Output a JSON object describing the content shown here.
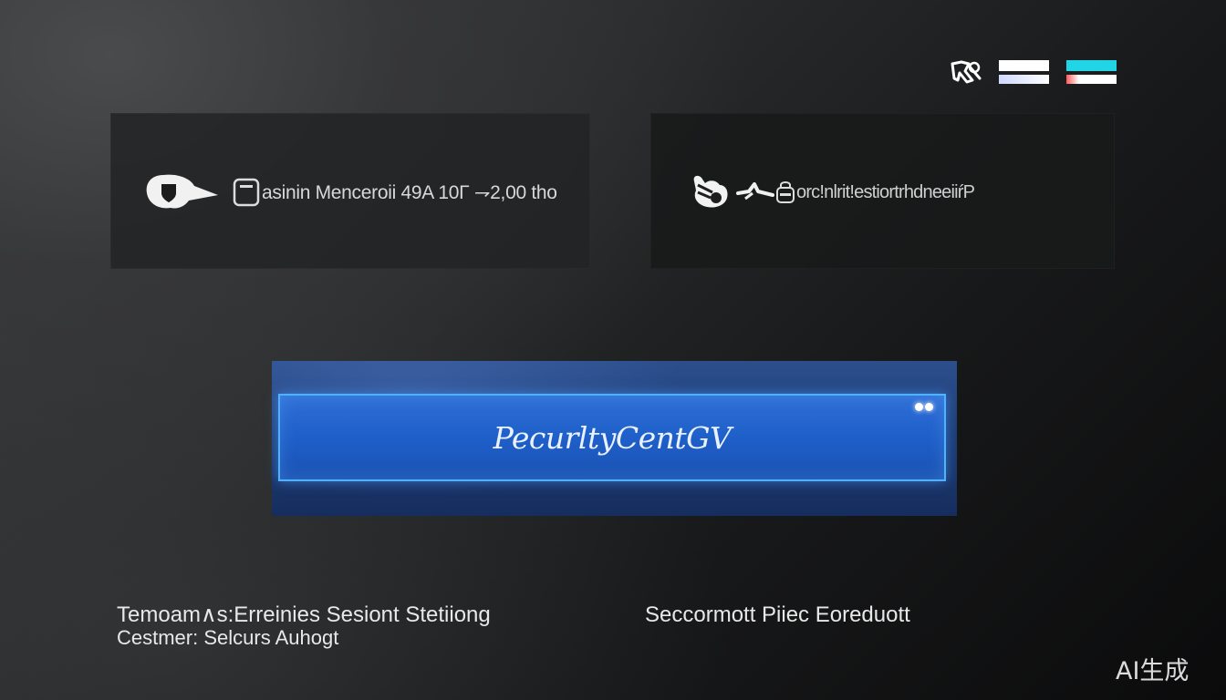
{
  "top_controls": {
    "logo_icon": "rk-logo-icon",
    "toggle_a_color": "#ffffff",
    "toggle_b_color": "#21d4e6"
  },
  "panels": [
    {
      "icon": "cloud-shield-icon",
      "secondary_icon": "document-icon",
      "text": "asinin Menceroii  49A 10Γ  ⇁2,00  tho"
    },
    {
      "icon": "rabbit-icon",
      "secondary_icon": "link-icon",
      "tertiary_icon": "lock-icon",
      "text": "orc!nlrit!estiortrhdneeiiŕP"
    }
  ],
  "hero": {
    "label": "PecurltyCentGV",
    "accent_color": "#4fb2ff"
  },
  "bottom_left": {
    "line1": "Temoam∧s:Erreinies Sesiont Stetiiong",
    "line2": "Cestmer: Selcurs Auhogt"
  },
  "bottom_right": {
    "line1": "Seccormott  Piiec  Eoreduott"
  },
  "watermark": "AI生成"
}
